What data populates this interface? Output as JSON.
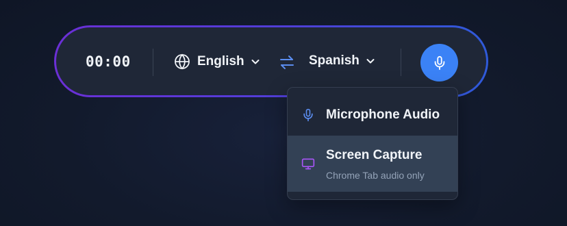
{
  "toolbar": {
    "timer": "00:00",
    "source_language": "English",
    "target_language": "Spanish",
    "icons": {
      "globe": "globe-icon",
      "chevron": "chevron-down-icon",
      "swap": "swap-arrows-icon",
      "mic": "microphone-icon"
    }
  },
  "audio_menu": {
    "items": [
      {
        "title": "Microphone Audio",
        "subtitle": "",
        "icon": "microphone-icon",
        "selected": false
      },
      {
        "title": "Screen Capture",
        "subtitle": "Chrome Tab audio only",
        "icon": "monitor-icon",
        "selected": true
      }
    ]
  },
  "colors": {
    "accent_blue": "#3b82f6",
    "accent_purple": "#a855f7",
    "border_gradient_start": "#6b2fd6",
    "border_gradient_end": "#2f5ad9",
    "panel_bg": "#1f2737",
    "selected_bg": "#334155"
  }
}
